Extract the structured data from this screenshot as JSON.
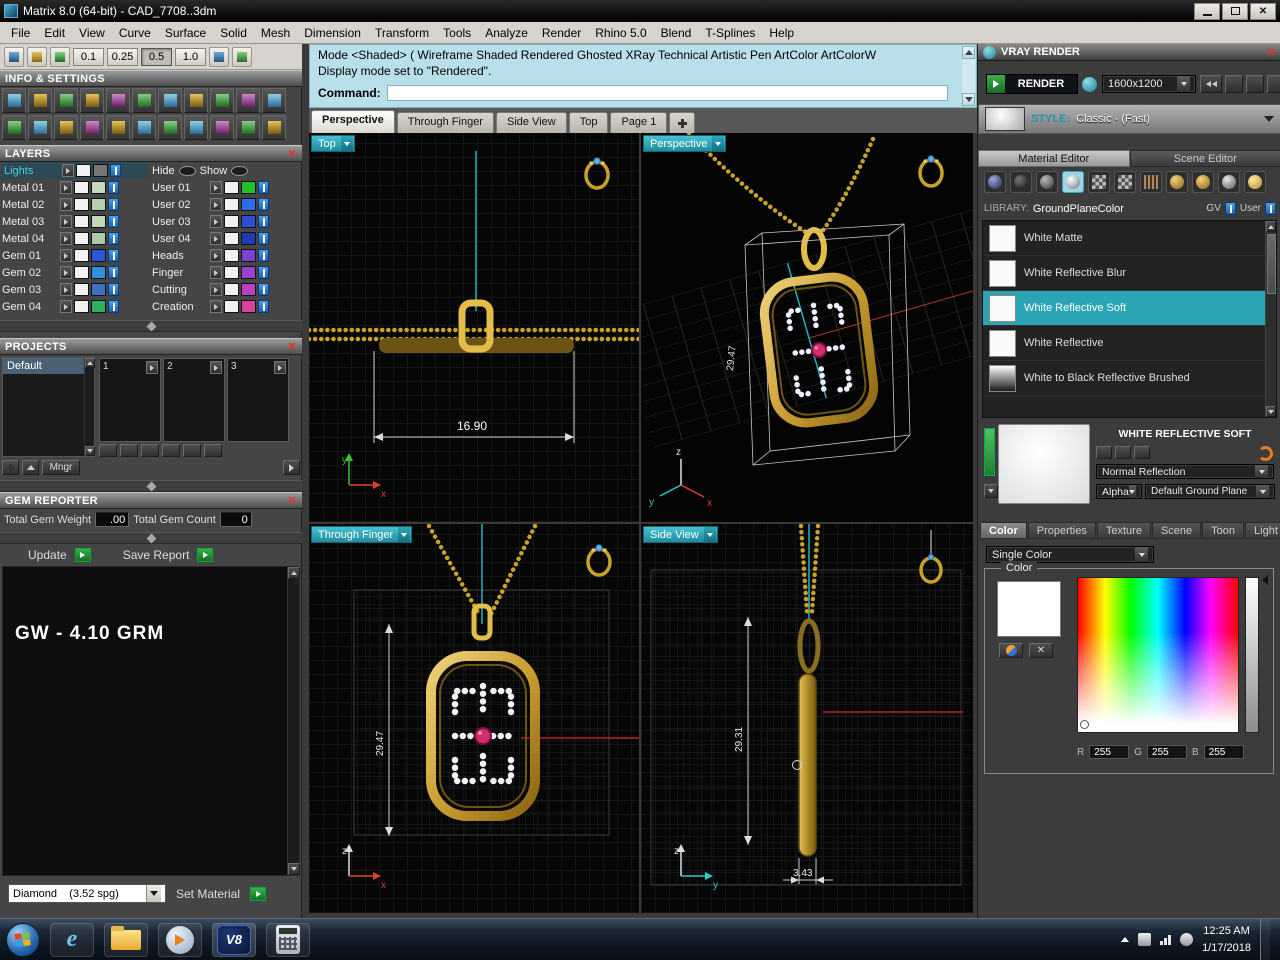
{
  "icons": {
    "close": "✕",
    "ie": "e",
    "v8": "V8"
  },
  "window": {
    "title": "Matrix 8.0 (64-bit) - CAD_7708..3dm"
  },
  "menu": {
    "items": [
      "File",
      "Edit",
      "View",
      "Curve",
      "Surface",
      "Solid",
      "Mesh",
      "Dimension",
      "Transform",
      "Tools",
      "Analyze",
      "Render",
      "Rhino 5.0",
      "Blend",
      "T-Splines",
      "Help"
    ]
  },
  "toolbar": {
    "snap_values": [
      "0.1",
      "0.25",
      "0.5",
      "1.0"
    ]
  },
  "command_area": {
    "history_line1": "Mode <Shaded> ( Wireframe  Shaded  Rendered  Ghosted  XRay  Technical  Artistic  Pen  ArtColor  ArtColorW",
    "history_line2": "Display mode set to \"Rendered\".",
    "prompt_label": "Command:"
  },
  "viewport_tabs": {
    "tabs": [
      "Perspective",
      "Through Finger",
      "Side View",
      "Top",
      "Page 1"
    ]
  },
  "viewports": {
    "top": {
      "label": "Top",
      "dim": "16.90",
      "axis_v": "y",
      "axis_h": "x"
    },
    "perspective": {
      "label": "Perspective",
      "dim": "29.47",
      "axis_up": "z",
      "axis_left": "y",
      "axis_right": "x"
    },
    "through_finger": {
      "label": "Through Finger",
      "dim": "29.47",
      "axis_up": "z",
      "axis_h": "x"
    },
    "side": {
      "label": "Side View",
      "dim_v": "29.31",
      "dim_h": "3.43",
      "axis_up": "z",
      "axis_h": "y"
    }
  },
  "left_panel": {
    "info_title": "INFO & SETTINGS",
    "layers": {
      "title": "LAYERS",
      "lights": "Lights",
      "hide": "Hide",
      "show": "Show",
      "rows": [
        {
          "l": "Metal 01",
          "lc": "#c8d8c0",
          "r": "User 01",
          "rc": "#21c12b"
        },
        {
          "l": "Metal 02",
          "lc": "#b6ceb0",
          "r": "User 02",
          "rc": "#2f6df0"
        },
        {
          "l": "Metal 03",
          "lc": "#c2d8ba",
          "r": "User 03",
          "rc": "#2b4fd0"
        },
        {
          "l": "Metal 04",
          "lc": "#aecba6",
          "r": "User 04",
          "rc": "#1f3cae"
        },
        {
          "l": "Gem 01",
          "lc": "#2f55d8",
          "r": "Heads",
          "rc": "#7d3fd0"
        },
        {
          "l": "Gem 02",
          "lc": "#2f8fd8",
          "r": "Finger",
          "rc": "#9a3fd0"
        },
        {
          "l": "Gem 03",
          "lc": "#3f6fc0",
          "r": "Cutting",
          "rc": "#b83fc0"
        },
        {
          "l": "Gem 04",
          "lc": "#2fb05f",
          "r": "Creation",
          "rc": "#d8439f"
        }
      ]
    },
    "projects": {
      "title": "PROJECTS",
      "default_item": "Default",
      "slots": [
        "1",
        "2",
        "3"
      ],
      "mngr": "Mngr"
    },
    "gem_reporter": {
      "title": "GEM REPORTER",
      "weight_label": "Total Gem Weight",
      "weight_value": ".00",
      "count_label": "Total Gem Count",
      "count_value": "0",
      "update": "Update",
      "save": "Save Report",
      "gw_text": "GW - 4.10 GRM"
    },
    "material_bar": {
      "value": "Diamond    (3.52 spg)",
      "set_label": "Set Material"
    }
  },
  "vray": {
    "title": "VRAY RENDER",
    "render": "RENDER",
    "resolution": "1600x1200",
    "style_label": "STYLE:",
    "style_value": "Classic - (Fast)",
    "tabs": [
      "Material Editor",
      "Scene Editor"
    ],
    "library_label": "LIBRARY:",
    "library_value": "GroundPlaneColor",
    "gv": "GV",
    "user": "User",
    "materials": [
      "White Matte",
      "White Reflective Blur",
      "White Reflective Soft",
      "White Reflective",
      "White to Black Reflective Brushed"
    ],
    "selected_material": "White Reflective Soft",
    "preview_title": "WHITE REFLECTIVE SOFT",
    "reflection": "Normal Reflection",
    "alpha": "Alpha",
    "ground_plane": "Default Ground Plane",
    "bottom_tabs": [
      "Color",
      "Properties",
      "Texture",
      "Scene",
      "Toon",
      "Light"
    ],
    "color_mode": "Single Color",
    "color_group": "Color",
    "rgb": {
      "r_label": "R",
      "r": "255",
      "g_label": "G",
      "g": "255",
      "b_label": "B",
      "b": "255"
    }
  },
  "taskbar": {
    "time": "12:25 AM",
    "date": "1/17/2018"
  }
}
